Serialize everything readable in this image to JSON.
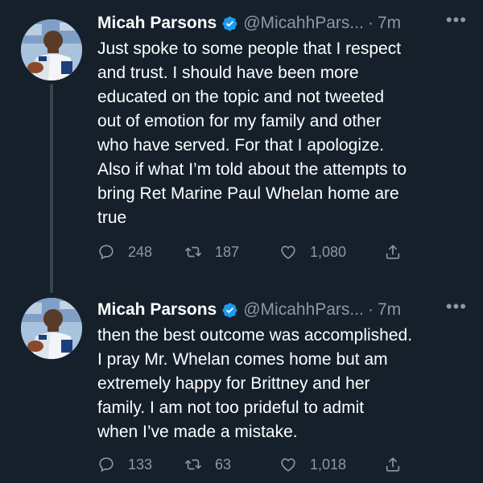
{
  "theme": {
    "background": "#15202b",
    "text": "#ffffff",
    "secondary": "#8b98a5",
    "verified": "#1d9bf0",
    "thread_line": "#38444d"
  },
  "tweets": [
    {
      "author_name": "Micah Parsons",
      "handle": "@MicahhPars...",
      "separator": "·",
      "time": "7m",
      "verified_icon": "verified-badge-icon",
      "more": "•••",
      "lines": [
        "Just spoke to some people that I respect",
        "and trust. I should have been more",
        "educated on the topic and not tweeted",
        "out of emotion for my family and other",
        "who have served. For that I apologize.",
        "Also if what I’m told about the attempts to",
        "bring Ret Marine Paul Whelan home are",
        "true"
      ],
      "replies": "248",
      "retweets": "187",
      "likes": "1,080"
    },
    {
      "author_name": "Micah Parsons",
      "handle": "@MicahhPars...",
      "separator": "·",
      "time": "7m",
      "verified_icon": "verified-badge-icon",
      "more": "•••",
      "lines": [
        "then the best outcome was accomplished.",
        "I pray Mr. Whelan comes home but am",
        "extremely happy for Brittney and her",
        "family.  I am not too prideful to admit",
        "when I’ve made a mistake."
      ],
      "replies": "133",
      "retweets": "63",
      "likes": "1,018"
    }
  ]
}
